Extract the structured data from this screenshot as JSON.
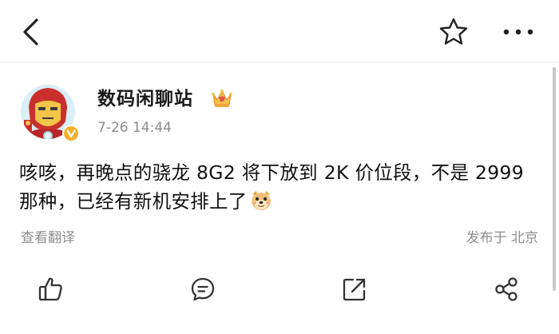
{
  "nav": {
    "back_icon": "chevron-left-icon",
    "favorite_icon": "star-outline-icon",
    "more_icon": "more-horizontal-icon"
  },
  "author": {
    "name": "数码闲聊站",
    "badge_icon": "crown-icon",
    "verified_icon": "verified-v-icon",
    "time": "7-26 14:44"
  },
  "post": {
    "text": "咳咳，再晚点的骁龙 8G2 将下放到 2K 价位段，不是 2999 那种，已经有新机安排上了",
    "emoji_icon": "doge-emoji-icon"
  },
  "footer": {
    "translate": "查看翻译",
    "location": "发布于 北京"
  },
  "actions": {
    "like_icon": "thumbs-up-icon",
    "comment_icon": "comment-icon",
    "repost_icon": "repost-icon",
    "share_icon": "share-icon"
  },
  "colors": {
    "text": "#111111",
    "secondary": "#8c8c8c",
    "accent": "#f2a93b"
  }
}
